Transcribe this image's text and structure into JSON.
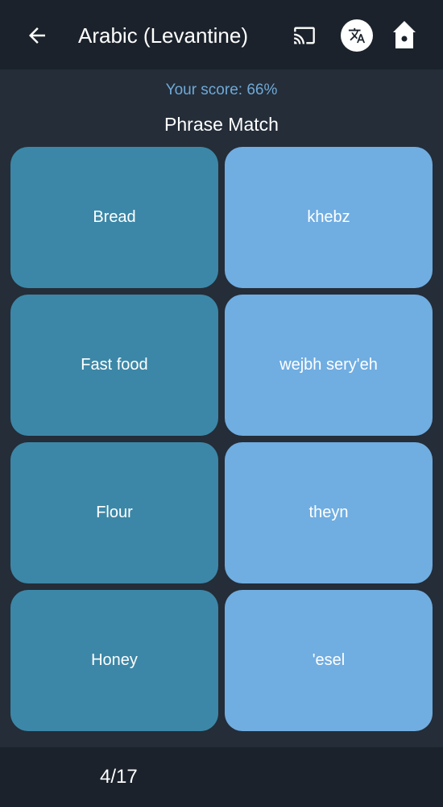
{
  "header": {
    "title": "Arabic (Levantine)",
    "icons": [
      "arrow-left-icon",
      "cast-icon",
      "translate-icon",
      "birdhouse-home-icon"
    ]
  },
  "score": {
    "label": "Your score: 66%"
  },
  "section": {
    "title": "Phrase Match"
  },
  "cards": {
    "terms": [
      "Bread",
      "Fast food",
      "Flour",
      "Honey"
    ],
    "translations": [
      "khebz",
      "wejbh sery'eh",
      "theyn",
      "'esel"
    ]
  },
  "footer": {
    "progress": "4/17"
  },
  "colors": {
    "background": "#242d38",
    "bar": "#1b222b",
    "score_text": "#6fa9d7",
    "term_card": "#3c87a7",
    "translation_card": "#70ade1"
  }
}
